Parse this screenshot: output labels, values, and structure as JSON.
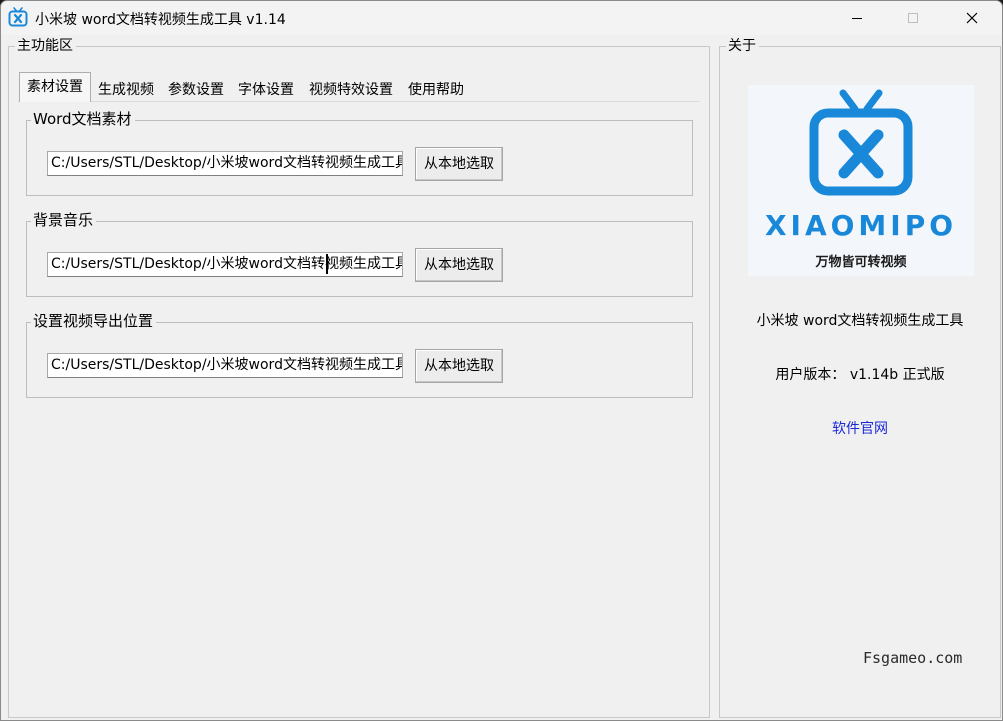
{
  "window": {
    "title": "小米坡 word文档转视频生成工具 v1.14",
    "controls": {
      "minimize_icon": "minimize-icon",
      "maximize_icon": "maximize-icon",
      "close_icon": "close-icon"
    }
  },
  "main": {
    "group_label": "主功能区",
    "tabs": [
      {
        "label": "素材设置",
        "active": true
      },
      {
        "label": "生成视频",
        "active": false
      },
      {
        "label": "参数设置",
        "active": false
      },
      {
        "label": "字体设置",
        "active": false
      },
      {
        "label": "视频特效设置",
        "active": false
      },
      {
        "label": "使用帮助",
        "active": false
      }
    ],
    "sections": [
      {
        "label": "Word文档素材",
        "path": "C:/Users/STL/Desktop/小米坡word文档转视频生成工具",
        "button": "从本地选取"
      },
      {
        "label": "背景音乐",
        "path": "C:/Users/STL/Desktop/小米坡word文档转视频生成工具",
        "button": "从本地选取"
      },
      {
        "label": "设置视频导出位置",
        "path": "C:/Users/STL/Desktop/小米坡word文档转视频生成工具",
        "button": "从本地选取"
      }
    ]
  },
  "about": {
    "group_label": "关于",
    "logo": {
      "brand": "XIAOMIPO",
      "tagline": "万物皆可转视频",
      "icon": "tv-logo-icon",
      "color": "#1a88d8"
    },
    "app_name": "小米坡 word文档转视频生成工具",
    "version": "用户版本： v1.14b 正式版",
    "website_link": "软件官网"
  },
  "watermark": "Fsgameo.com",
  "colors": {
    "accent": "#1a88d8",
    "link": "#1a28d8",
    "window_bg": "#f0f0f0"
  }
}
